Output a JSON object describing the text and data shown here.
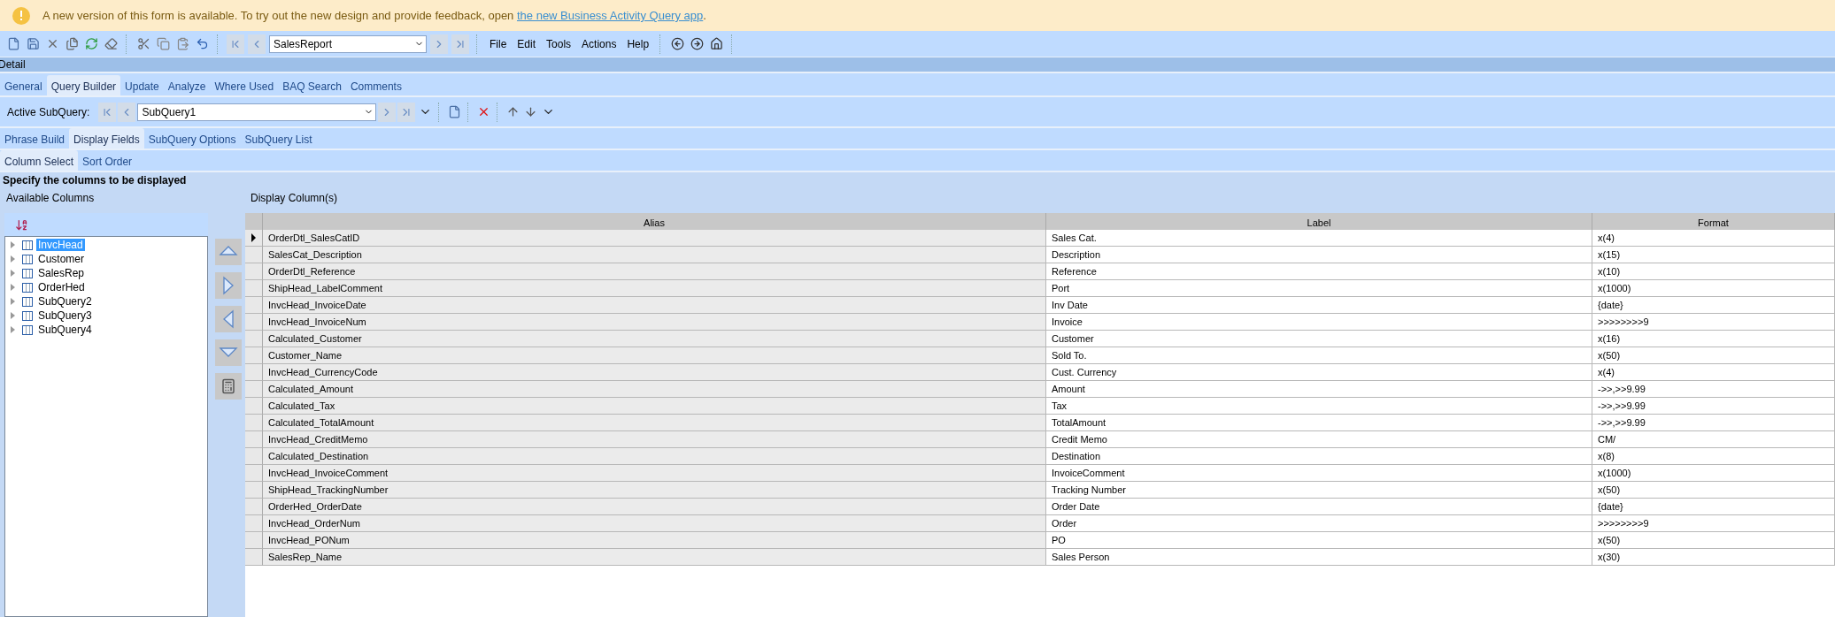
{
  "banner": {
    "text": "A new version of this form is available. To try out the new design and provide feedback, open ",
    "link": "the new Business Activity Query app",
    "suffix": "."
  },
  "toolbar": {
    "report": "SalesReport",
    "menu": [
      "File",
      "Edit",
      "Tools",
      "Actions",
      "Help"
    ]
  },
  "section_title": "Detail",
  "tabs": [
    {
      "label": "General",
      "selected": false
    },
    {
      "label": "Query Builder",
      "selected": true
    },
    {
      "label": "Update",
      "selected": false
    },
    {
      "label": "Analyze",
      "selected": false
    },
    {
      "label": "Where Used",
      "selected": false
    },
    {
      "label": "BAQ Search",
      "selected": false
    },
    {
      "label": "Comments",
      "selected": false
    }
  ],
  "subquery": {
    "label": "Active SubQuery:",
    "value": "SubQuery1"
  },
  "subquery_tabs": [
    {
      "label": "Phrase Build",
      "selected": false
    },
    {
      "label": "Display Fields",
      "selected": true
    },
    {
      "label": "SubQuery Options",
      "selected": false
    },
    {
      "label": "SubQuery List",
      "selected": false
    }
  ],
  "column_tabs": [
    {
      "label": "Column Select",
      "selected": true
    },
    {
      "label": "Sort Order",
      "selected": false
    }
  ],
  "instruction": "Specify the columns to be displayed",
  "available_columns": {
    "title": "Available Columns",
    "items": [
      {
        "label": "InvcHead",
        "selected": true
      },
      {
        "label": "Customer",
        "selected": false
      },
      {
        "label": "SalesRep",
        "selected": false
      },
      {
        "label": "OrderHed",
        "selected": false
      },
      {
        "label": "SubQuery2",
        "selected": false
      },
      {
        "label": "SubQuery3",
        "selected": false
      },
      {
        "label": "SubQuery4",
        "selected": false
      }
    ]
  },
  "display_columns": {
    "title": "Display Column(s)",
    "columns": [
      "Alias",
      "Label",
      "Format"
    ],
    "rows": [
      {
        "alias": "OrderDtl_SalesCatID",
        "label": "Sales Cat.",
        "format": "x(4)",
        "selected": true
      },
      {
        "alias": "SalesCat_Description",
        "label": "Description",
        "format": "x(15)",
        "selected": false
      },
      {
        "alias": "OrderDtl_Reference",
        "label": "Reference",
        "format": "x(10)",
        "selected": false
      },
      {
        "alias": "ShipHead_LabelComment",
        "label": "Port",
        "format": "x(1000)",
        "selected": false
      },
      {
        "alias": "InvcHead_InvoiceDate",
        "label": "Inv Date",
        "format": "{date}",
        "selected": false
      },
      {
        "alias": "InvcHead_InvoiceNum",
        "label": "Invoice",
        "format": ">>>>>>>>9",
        "selected": false
      },
      {
        "alias": "Calculated_Customer",
        "label": "Customer",
        "format": "x(16)",
        "selected": false
      },
      {
        "alias": "Customer_Name",
        "label": "Sold To.",
        "format": "x(50)",
        "selected": false
      },
      {
        "alias": "InvcHead_CurrencyCode",
        "label": "Cust. Currency",
        "format": "x(4)",
        "selected": false
      },
      {
        "alias": "Calculated_Amount",
        "label": "Amount",
        "format": "->>,>>9.99",
        "selected": false
      },
      {
        "alias": "Calculated_Tax",
        "label": "Tax",
        "format": "->>,>>9.99",
        "selected": false
      },
      {
        "alias": "Calculated_TotalAmount",
        "label": "TotalAmount",
        "format": "->>,>>9.99",
        "selected": false
      },
      {
        "alias": "InvcHead_CreditMemo",
        "label": "Credit Memo",
        "format": "CM/",
        "selected": false
      },
      {
        "alias": "Calculated_Destination",
        "label": "Destination",
        "format": "x(8)",
        "selected": false
      },
      {
        "alias": "InvcHead_InvoiceComment",
        "label": "InvoiceComment",
        "format": "x(1000)",
        "selected": false
      },
      {
        "alias": "ShipHead_TrackingNumber",
        "label": "Tracking Number",
        "format": "x(50)",
        "selected": false
      },
      {
        "alias": "OrderHed_OrderDate",
        "label": "Order Date",
        "format": "{date}",
        "selected": false
      },
      {
        "alias": "InvcHead_OrderNum",
        "label": "Order",
        "format": ">>>>>>>>9",
        "selected": false
      },
      {
        "alias": "InvcHead_PONum",
        "label": "PO",
        "format": "x(50)",
        "selected": false
      },
      {
        "alias": "SalesRep_Name",
        "label": "Sales Person",
        "format": "x(30)",
        "selected": false
      }
    ]
  }
}
